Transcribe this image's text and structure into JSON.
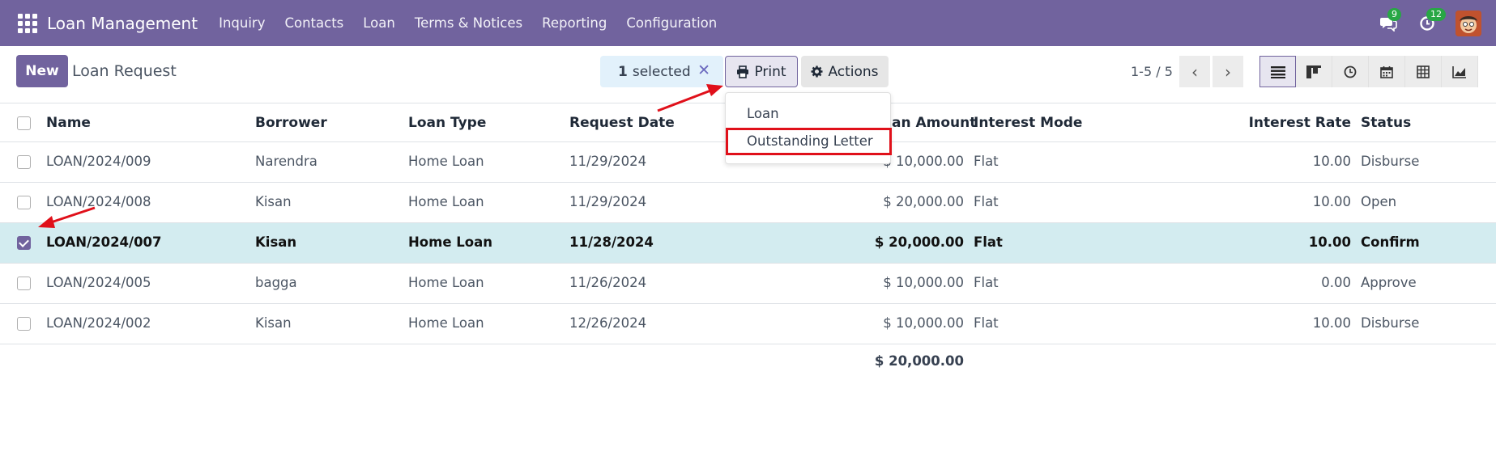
{
  "navbar": {
    "brand": "Loan Management",
    "menu": [
      "Inquiry",
      "Contacts",
      "Loan",
      "Terms & Notices",
      "Reporting",
      "Configuration"
    ],
    "messages_count": "9",
    "activities_count": "12",
    "color": "#71639e"
  },
  "control_panel": {
    "new_label": "New",
    "title": "Loan Request",
    "selected_count": "1",
    "selected_label": "selected",
    "print_label": "Print",
    "actions_label": "Actions",
    "pager": "1-5 / 5",
    "views": [
      "list-icon",
      "kanban-icon",
      "activity-icon",
      "calendar-icon",
      "pivot-icon",
      "graph-icon"
    ]
  },
  "print_menu": {
    "items": [
      "Loan",
      "Outstanding Letter"
    ],
    "highlighted": "Outstanding Letter"
  },
  "table": {
    "columns": [
      "Name",
      "Borrower",
      "Loan Type",
      "Request Date",
      "an Amount",
      "Interest Mode",
      "Interest Rate",
      "Status"
    ],
    "rows": [
      {
        "name": "LOAN/2024/009",
        "borrower": "Narendra",
        "type": "Home Loan",
        "date": "11/29/2024",
        "amount": "$ 10,000.00",
        "mode": "Flat",
        "rate": "10.00",
        "status": "Disburse",
        "checked": false
      },
      {
        "name": "LOAN/2024/008",
        "borrower": "Kisan",
        "type": "Home Loan",
        "date": "11/29/2024",
        "amount": "$ 20,000.00",
        "mode": "Flat",
        "rate": "10.00",
        "status": "Open",
        "checked": false
      },
      {
        "name": "LOAN/2024/007",
        "borrower": "Kisan",
        "type": "Home Loan",
        "date": "11/28/2024",
        "amount": "$ 20,000.00",
        "mode": "Flat",
        "rate": "10.00",
        "status": "Confirm",
        "checked": true
      },
      {
        "name": "LOAN/2024/005",
        "borrower": "bagga",
        "type": "Home Loan",
        "date": "11/26/2024",
        "amount": "$ 10,000.00",
        "mode": "Flat",
        "rate": "0.00",
        "status": "Approve",
        "checked": false
      },
      {
        "name": "LOAN/2024/002",
        "borrower": "Kisan",
        "type": "Home Loan",
        "date": "12/26/2024",
        "amount": "$ 10,000.00",
        "mode": "Flat",
        "rate": "10.00",
        "status": "Disburse",
        "checked": false
      }
    ],
    "total": "$ 20,000.00"
  }
}
